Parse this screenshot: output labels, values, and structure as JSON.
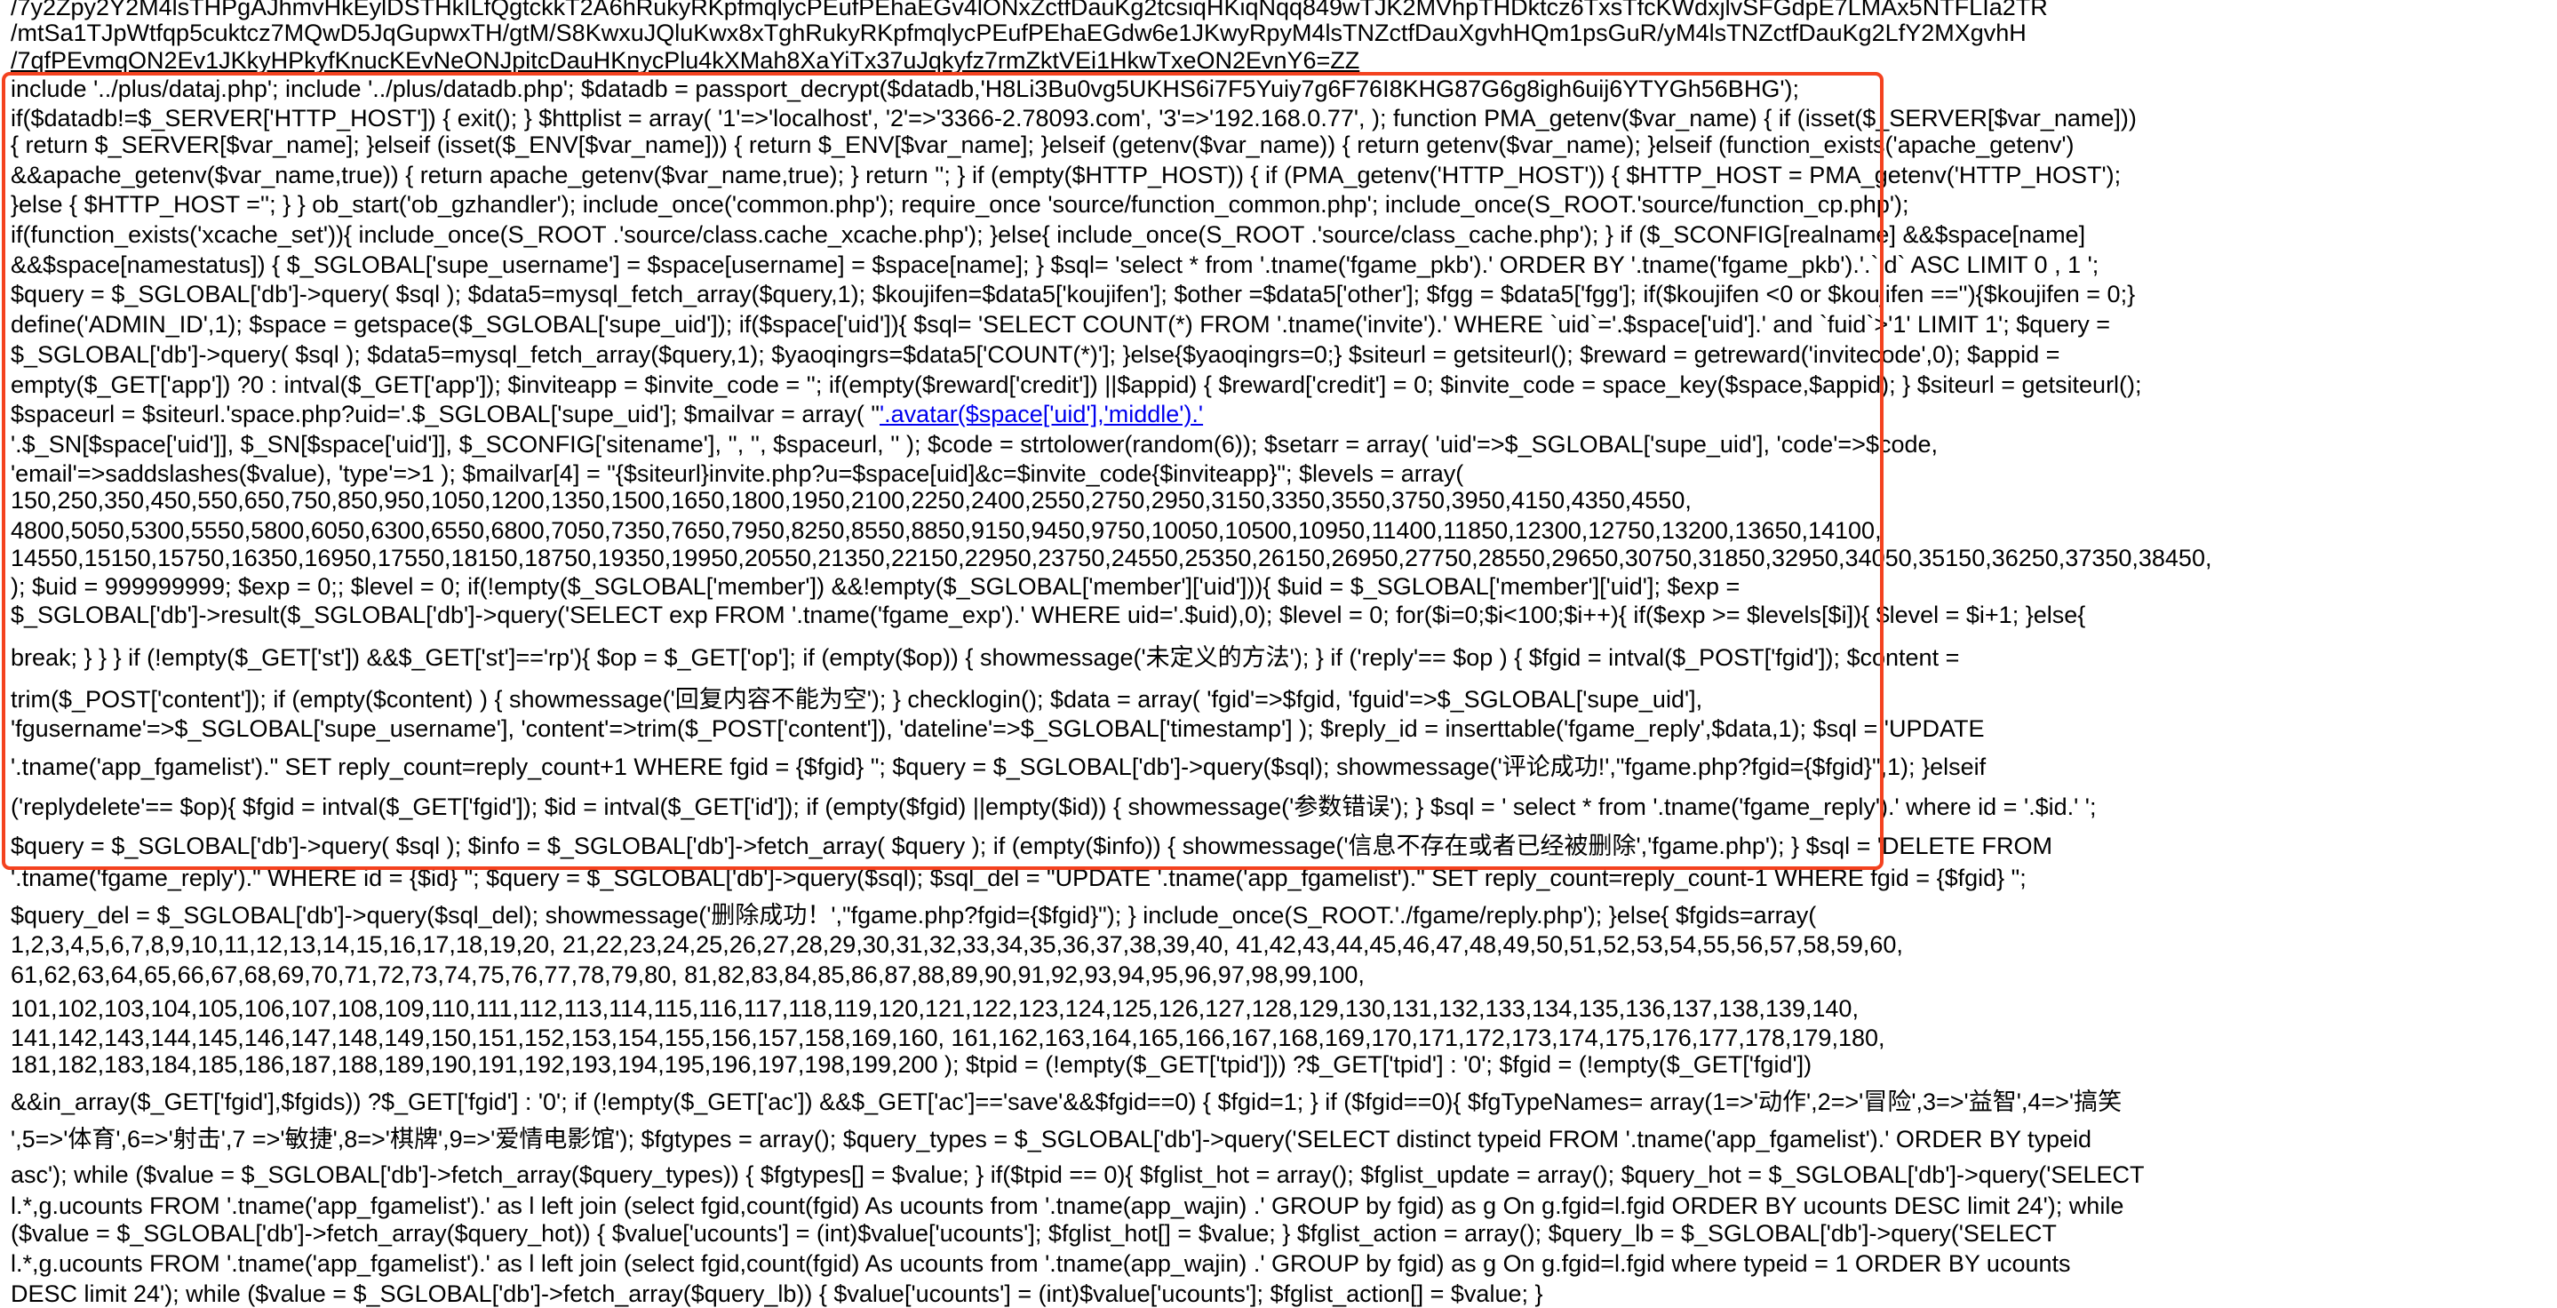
{
  "highlight_color": "#f4421f",
  "link_color": "#0000ee",
  "code_lines": [
    {
      "text": "/7y2Zpy2Y2M4lsTHPgAJhmvHkEylDSTHkILfQgtckkT2A6hRukyRKpfmqlycPEufPEhaEGv4lONxZctfDauKg2tcsiqHKiqNqq849wTJK2MVhpTHDktcz6TxsTfcKWdxjlvSFGdpE7LMAx5NTFLIa2TR"
    },
    {
      "text": "/mtSa1TJpWtfqp5cuktcz7MQwD5JqGupwxTH/gtM/S8KwxuJQluKwx8xTghRukyRKpfmqlycPEufPEhaEGdw6e1JKwyRpyM4lsTNZctfDauXgvhHQm1psGuR/yM4lsTNZctfDauKg2LfY2MXgvhH"
    },
    {
      "text": "/7qfPEvmqON2Ev1JKkyHPkyfKnucKEvNeONJpitcDauHKnycPlu4kXMah8XaYiTx37uJqkyfz7rmZktVEi1HkwTxeON2EvnY6=ZZ",
      "underlined": true
    },
    {
      "text": "include '../plus/dataj.php'; include '../plus/datadb.php'; $datadb = passport_decrypt($datadb,'H8Li3Bu0vg5UKHS6i7F5Yuiy7g6F76I8KHG87G6g8igh6uij6YTYGh56BHG');"
    },
    {
      "text": "if($datadb!=$_SERVER['HTTP_HOST']) { exit(); } $httplist = array( '1'=>'localhost', '2'=>'3366-2.78093.com', '3'=>'192.168.0.77', ); function PMA_getenv($var_name) { if (isset($_SERVER[$var_name]))"
    },
    {
      "text": "{ return $_SERVER[$var_name]; }elseif (isset($_ENV[$var_name])) { return $_ENV[$var_name]; }elseif (getenv($var_name)) { return getenv($var_name); }elseif (function_exists('apache_getenv')"
    },
    {
      "text": "&&apache_getenv($var_name,true)) { return apache_getenv($var_name,true); } return ''; } if (empty($HTTP_HOST)) { if (PMA_getenv('HTTP_HOST')) { $HTTP_HOST = PMA_getenv('HTTP_HOST');"
    },
    {
      "text": "}else { $HTTP_HOST =''; } } ob_start('ob_gzhandler'); include_once('common.php'); require_once 'source/function_common.php'; include_once(S_ROOT.'source/function_cp.php');"
    },
    {
      "text": "if(function_exists('xcache_set')){ include_once(S_ROOT .'source/class.cache_xcache.php'); }else{ include_once(S_ROOT .'source/class_cache.php'); } if ($_SCONFIG[realname] &&$space[name]"
    },
    {
      "text": "&&$space[namestatus]) { $_SGLOBAL['supe_username'] = $space[username] = $space[name]; } $sql= 'select * from '.tname('fgame_pkb').' ORDER BY '.tname('fgame_pkb').'.`id` ASC LIMIT 0 , 1 ';"
    },
    {
      "text": "$query = $_SGLOBAL['db']->query( $sql ); $data5=mysql_fetch_array($query,1); $koujifen=$data5['koujifen']; $other =$data5['other']; $fgg = $data5['fgg']; if($koujifen <0 or $koujifen ==''){$koujifen = 0;}"
    },
    {
      "text": "define('ADMIN_ID',1); $space = getspace($_SGLOBAL['supe_uid']); if($space['uid']){ $sql= 'SELECT COUNT(*) FROM '.tname('invite').' WHERE `uid`='.$space['uid'].' and `fuid`>'1' LIMIT 1'; $query ="
    },
    {
      "text": "$_SGLOBAL['db']->query( $sql ); $data5=mysql_fetch_array($query,1); $yaoqingrs=$data5['COUNT(*)']; }else{$yaoqingrs=0;} $siteurl = getsiteurl(); $reward = getreward('invitecode',0); $appid ="
    },
    {
      "text": "empty($_GET['app']) ?0 : intval($_GET['app']); $inviteapp = $invite_code = ''; if(empty($reward['credit']) ||$appid) { $reward['credit'] = 0; $invite_code = space_key($space,$appid); } $siteurl = getsiteurl();"
    },
    {
      "text": "$spaceurl = $siteurl.'space.php?uid='.$_SGLOBAL['supe_uid']; $mailvar = array( \"",
      "link": "'.avatar($space['uid'],'middle').'"
    },
    {
      "text": "'.$_SN[$space['uid']], $_SN[$space['uid']], $_SCONFIG['sitename'], '', '', $spaceurl, '' ); $code = strtolower(random(6)); $setarr = array( 'uid'=>$_SGLOBAL['supe_uid'], 'code'=>$code,"
    },
    {
      "text": "'email'=>saddslashes($value), 'type'=>1 ); $mailvar[4] = \"{$siteurl}invite.php?u=$space[uid]&c=$invite_code{$inviteapp}\"; $levels = array("
    },
    {
      "text": "150,250,350,450,550,650,750,850,950,1050,1200,1350,1500,1650,1800,1950,2100,2250,2400,2550,2750,2950,3150,3350,3550,3750,3950,4150,4350,4550,"
    },
    {
      "text": "4800,5050,5300,5550,5800,6050,6300,6550,6800,7050,7350,7650,7950,8250,8550,8850,9150,9450,9750,10050,10500,10950,11400,11850,12300,12750,13200,13650,14100,"
    },
    {
      "text": "14550,15150,15750,16350,16950,17550,18150,18750,19350,19950,20550,21350,22150,22950,23750,24550,25350,26150,26950,27750,28550,29650,30750,31850,32950,34050,35150,36250,37350,38450,"
    },
    {
      "text": "); $uid = 999999999; $exp = 0;; $level = 0; if(!empty($_SGLOBAL['member']) &&!empty($_SGLOBAL['member']['uid'])){ $uid = $_SGLOBAL['member']['uid']; $exp ="
    },
    {
      "text": "$_SGLOBAL['db']->result($_SGLOBAL['db']->query('SELECT exp FROM '.tname('fgame_exp').' WHERE uid='.$uid),0); $level = 0; for($i=0;$i<100;$i++){ if($exp >= $levels[$i]){ $level = $i+1; }else{"
    },
    {
      "text": "break; } } } if (!empty($_GET['st']) &&$_GET['st']=='rp'){ $op = $_GET['op']; if (empty($op)) { showmessage('未定义的方法'); } if ('reply'== $op ) { $fgid = intval($_POST['fgid']); $content ="
    },
    {
      "text": "trim($_POST['content']); if (empty($content) ) { showmessage('回复内容不能为空'); } checklogin(); $data = array( 'fgid'=>$fgid, 'fguid'=>$_SGLOBAL['supe_uid'],"
    },
    {
      "text": "'fgusername'=>$_SGLOBAL['supe_username'], 'content'=>trim($_POST['content']), 'dateline'=>$_SGLOBAL['timestamp'] ); $reply_id = inserttable('fgame_reply',$data,1); $sql = 'UPDATE"
    },
    {
      "text": "'.tname('app_fgamelist').\" SET reply_count=reply_count+1 WHERE fgid = {$fgid} \"; $query = $_SGLOBAL['db']->query($sql); showmessage('评论成功!',\"fgame.php?fgid={$fgid}\",1); }elseif"
    },
    {
      "text": "('replydelete'== $op){ $fgid = intval($_GET['fgid']); $id = intval($_GET['id']); if (empty($fgid) ||empty($id)) { showmessage('参数错误'); } $sql = ' select * from '.tname('fgame_reply').' where id = '.$id.' ';"
    },
    {
      "text": "$query = $_SGLOBAL['db']->query( $sql ); $info = $_SGLOBAL['db']->fetch_array( $query ); if (empty($info)) { showmessage('信息不存在或者已经被删除','fgame.php'); } $sql = 'DELETE FROM"
    },
    {
      "text": "'.tname('fgame_reply').\" WHERE id = {$id} \"; $query = $_SGLOBAL['db']->query($sql); $sql_del = \"UPDATE '.tname('app_fgamelist').\" SET reply_count=reply_count-1 WHERE fgid = {$fgid} \";"
    },
    {
      "text": "$query_del = $_SGLOBAL['db']->query($sql_del); showmessage('删除成功！',\"fgame.php?fgid={$fgid}\"); } include_once(S_ROOT.'./fgame/reply.php'); }else{ $fgids=array("
    },
    {
      "text": "1,2,3,4,5,6,7,8,9,10,11,12,13,14,15,16,17,18,19,20, 21,22,23,24,25,26,27,28,29,30,31,32,33,34,35,36,37,38,39,40, 41,42,43,44,45,46,47,48,49,50,51,52,53,54,55,56,57,58,59,60,"
    },
    {
      "text": "61,62,63,64,65,66,67,68,69,70,71,72,73,74,75,76,77,78,79,80, 81,82,83,84,85,86,87,88,89,90,91,92,93,94,95,96,97,98,99,100,"
    },
    {
      "text": "101,102,103,104,105,106,107,108,109,110,111,112,113,114,115,116,117,118,119,120,121,122,123,124,125,126,127,128,129,130,131,132,133,134,135,136,137,138,139,140,"
    },
    {
      "text": "141,142,143,144,145,146,147,148,149,150,151,152,153,154,155,156,157,158,169,160, 161,162,163,164,165,166,167,168,169,170,171,172,173,174,175,176,177,178,179,180,"
    },
    {
      "text": "181,182,183,184,185,186,187,188,189,190,191,192,193,194,195,196,197,198,199,200 ); $tpid = (!empty($_GET['tpid'])) ?$_GET['tpid'] : '0'; $fgid = (!empty($_GET['fgid'])"
    },
    {
      "text": "&&in_array($_GET['fgid'],$fgids)) ?$_GET['fgid'] : '0'; if (!empty($_GET['ac']) &&$_GET['ac']=='save'&&$fgid==0) { $fgid=1; } if ($fgid==0){ $fgTypeNames= array(1=>'动作',2=>'冒险',3=>'益智',4=>'搞笑"
    },
    {
      "text": "',5=>'体育',6=>'射击',7 =>'敏捷',8=>'棋牌',9=>'爱情电影馆'); $fgtypes = array(); $query_types = $_SGLOBAL['db']->query('SELECT distinct typeid FROM '.tname('app_fgamelist').' ORDER BY typeid"
    },
    {
      "text": "asc'); while ($value = $_SGLOBAL['db']->fetch_array($query_types)) { $fgtypes[] = $value; } if($tpid == 0){ $fglist_hot = array(); $fglist_update = array(); $query_hot = $_SGLOBAL['db']->query('SELECT"
    },
    {
      "text": "l.*,g.ucounts FROM '.tname('app_fgamelist').' as l left join (select fgid,count(fgid) As ucounts from '.tname(app_wajin) .' GROUP by fgid) as g On g.fgid=l.fgid ORDER BY ucounts DESC limit 24'); while"
    },
    {
      "text": "($value = $_SGLOBAL['db']->fetch_array($query_hot)) { $value['ucounts'] = (int)$value['ucounts']; $fglist_hot[] = $value; } $fglist_action = array(); $query_lb = $_SGLOBAL['db']->query('SELECT"
    },
    {
      "text": "l.*,g.ucounts FROM '.tname('app_fgamelist').' as l left join (select fgid,count(fgid) As ucounts from '.tname(app_wajin) .' GROUP by fgid) as g On g.fgid=l.fgid where typeid = 1 ORDER BY ucounts"
    },
    {
      "text": "DESC limit 24'); while ($value = $_SGLOBAL['db']->fetch_array($query_lb)) { $value['ucounts'] = (int)$value['ucounts']; $fglist_action[] = $value; }"
    }
  ]
}
